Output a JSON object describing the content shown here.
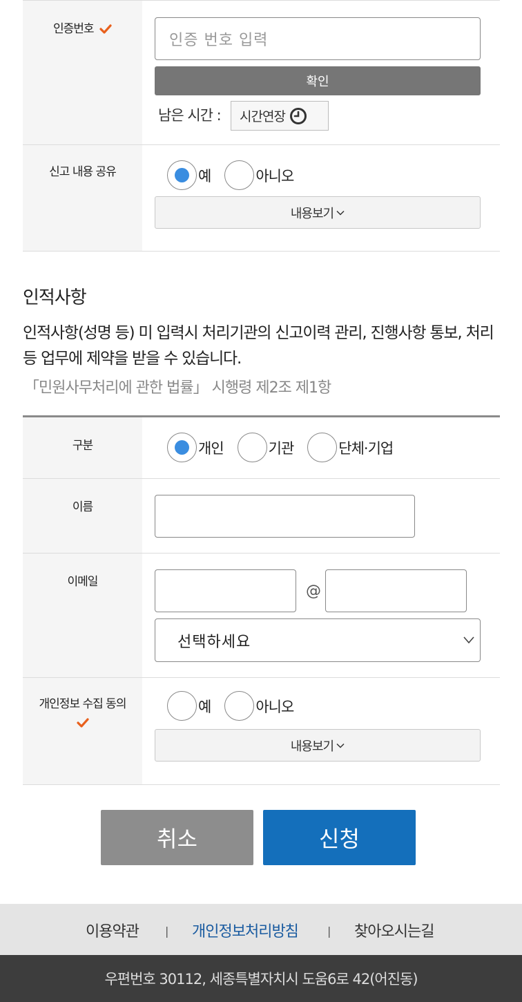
{
  "auth": {
    "label": "인증번호",
    "placeholder": "인증 번호 입력",
    "confirm_label": "확인",
    "time_label": "남은 시간 :",
    "extend_label": "시간연장"
  },
  "share": {
    "label": "신고 내용 공유",
    "options": [
      {
        "label": "예",
        "selected": true
      },
      {
        "label": "아니오",
        "selected": false
      }
    ],
    "view_label": "내용보기"
  },
  "personal": {
    "title": "인적사항",
    "notice": "인적사항(성명 등) 미 입력시 처리기관의 신고이력 관리, 진행사항 통보, 처리 등 업무에 제약을 받을 수 있습니다.",
    "law": "「민원사무처리에 관한 법률」 시행령 제2조 제1항",
    "type": {
      "label": "구분",
      "options": [
        {
          "label": "개인",
          "selected": true
        },
        {
          "label": "기관",
          "selected": false
        },
        {
          "label": "단체·기업",
          "selected": false
        }
      ]
    },
    "name": {
      "label": "이름",
      "value": ""
    },
    "email": {
      "label": "이메일",
      "local_value": "",
      "at": "@",
      "domain_value": "",
      "select_value": "선택하세요"
    },
    "consent": {
      "label": "개인정보 수집 동의",
      "options": [
        {
          "label": "예",
          "selected": false
        },
        {
          "label": "아니오",
          "selected": false
        }
      ],
      "view_label": "내용보기"
    }
  },
  "actions": {
    "cancel_label": "취소",
    "submit_label": "신청"
  },
  "footer": {
    "links": [
      "이용약관",
      "개인정보처리방침",
      "찾아오시는길"
    ],
    "separator": "|",
    "address": "우편번호 30112, 세종특별자치시 도움6로 42(어진동)"
  },
  "colors": {
    "accent": "#146fbb",
    "required_mark": "#e8601c",
    "radio_selected": "#3a8de0"
  }
}
